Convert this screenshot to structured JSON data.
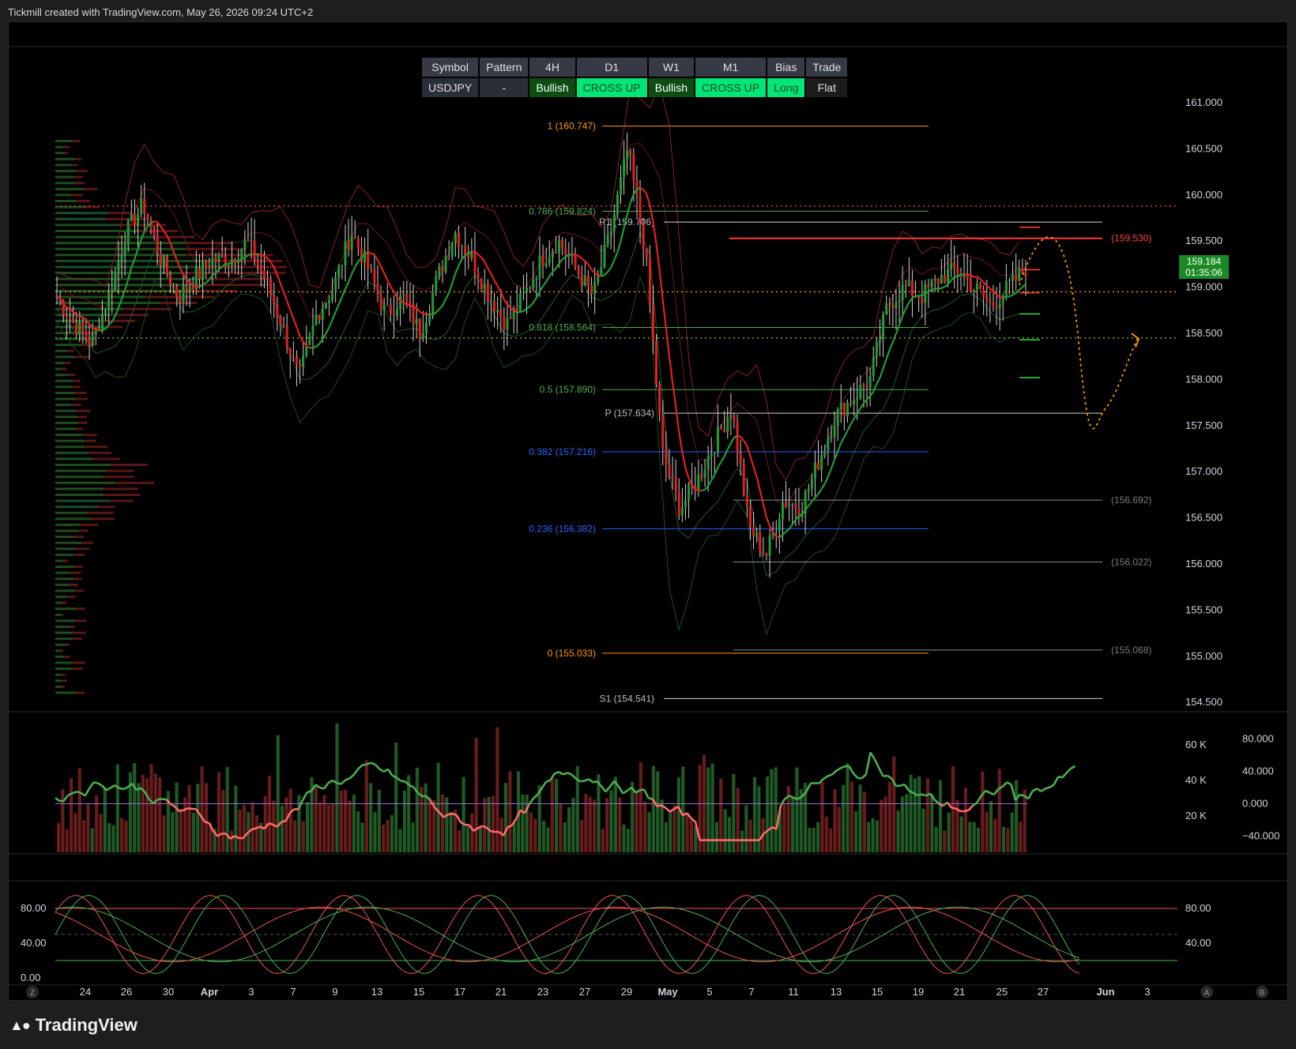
{
  "header": {
    "text": "Tickmill created with TradingView.com, May 26, 2026 09:24 UTC+2"
  },
  "footer": {
    "brand": "TradingView"
  },
  "status_table": {
    "headers": [
      "Symbol",
      "Pattern",
      "4H",
      "D1",
      "W1",
      "M1",
      "Bias",
      "Trade"
    ],
    "values": [
      "USDJPY",
      "-",
      "Bullish",
      "CROSS UP",
      "Bullish",
      "CROSS UP",
      "Long",
      "Flat"
    ]
  },
  "colors": {
    "bull": "#26a69a",
    "bear": "#ef5350",
    "orange": "#ff9800",
    "fib_blue": "#2962ff",
    "badge": "#1b8a24"
  },
  "price_badge": {
    "price": "159.184",
    "countdown": "01:35:06"
  },
  "chart_data": [
    {
      "type": "candlestick",
      "symbol": "USDJPY",
      "y_axis_ticks": [
        "161.000",
        "160.500",
        "160.000",
        "159.500",
        "159.000",
        "158.500",
        "158.000",
        "157.500",
        "157.000",
        "156.500",
        "156.000",
        "155.500",
        "155.000",
        "154.500"
      ],
      "ylim": [
        154.45,
        161.3
      ],
      "x_axis_ticks": [
        "24",
        "26",
        "30",
        "Apr",
        "3",
        "7",
        "9",
        "13",
        "15",
        "17",
        "21",
        "23",
        "27",
        "29",
        "May",
        "5",
        "7",
        "11",
        "13",
        "15",
        "19",
        "21",
        "25",
        "27",
        "Jun",
        "3"
      ],
      "closes_approx": [
        158.9,
        158.6,
        158.4,
        158.9,
        159.6,
        159.9,
        159.3,
        158.9,
        159.1,
        159.3,
        159.3,
        159.5,
        159.1,
        158.6,
        158.0,
        158.7,
        159.0,
        159.6,
        159.2,
        158.7,
        158.9,
        158.5,
        159.1,
        159.6,
        159.3,
        158.9,
        158.6,
        158.9,
        159.3,
        159.5,
        159.2,
        158.9,
        159.6,
        160.5,
        159.4,
        157.2,
        156.6,
        156.9,
        157.3,
        157.7,
        156.4,
        156.1,
        156.7,
        156.6,
        157.1,
        157.6,
        157.8,
        158.0,
        158.8,
        159.0,
        158.9,
        159.1,
        159.2,
        159.0,
        158.8,
        159.0,
        159.2
      ],
      "fib_levels": [
        {
          "label": "1 (160.747)",
          "value": 160.747
        },
        {
          "label": "0.786 (159.824)",
          "value": 159.824
        },
        {
          "label": "0.618 (158.564)",
          "value": 158.564
        },
        {
          "label": "0.5 (157.890)",
          "value": 157.89
        },
        {
          "label": "0.382 (157.216)",
          "value": 157.216
        },
        {
          "label": "0.236 (156.382)",
          "value": 156.382
        },
        {
          "label": "0 (155.033)",
          "value": 155.033
        }
      ],
      "pivot_levels": [
        {
          "label": "R1 (159.706)",
          "value": 159.706
        },
        {
          "label": "P (157.634)",
          "value": 157.634
        },
        {
          "label": "S1 (154.541)",
          "value": 154.541
        }
      ],
      "right_labels": [
        {
          "label": "(159.530)",
          "value": 159.53
        },
        {
          "label": "(156.692)",
          "value": 156.692
        },
        {
          "label": "(156.022)",
          "value": 156.022
        },
        {
          "label": "(155.068)",
          "value": 155.068
        }
      ],
      "dotted_levels": [
        159.88,
        158.95,
        158.45
      ]
    },
    {
      "type": "bar",
      "name": "volume",
      "y_axis_ticks_left": [
        "60 K",
        "40 K",
        "20 K"
      ],
      "y_axis_ticks_right": [
        "80.000",
        "40.000",
        "0.000",
        "−40.000"
      ],
      "ylim": [
        0,
        72000
      ],
      "oscillator_ylim": [
        -60,
        100
      ]
    },
    {
      "type": "line",
      "name": "stochastic",
      "y_axis_ticks_left": [
        "80.00",
        "40.00",
        "0.00"
      ],
      "y_axis_ticks_right": [
        "80.00",
        "40.00"
      ],
      "ylim": [
        0,
        100
      ],
      "levels": [
        80,
        20
      ]
    }
  ]
}
